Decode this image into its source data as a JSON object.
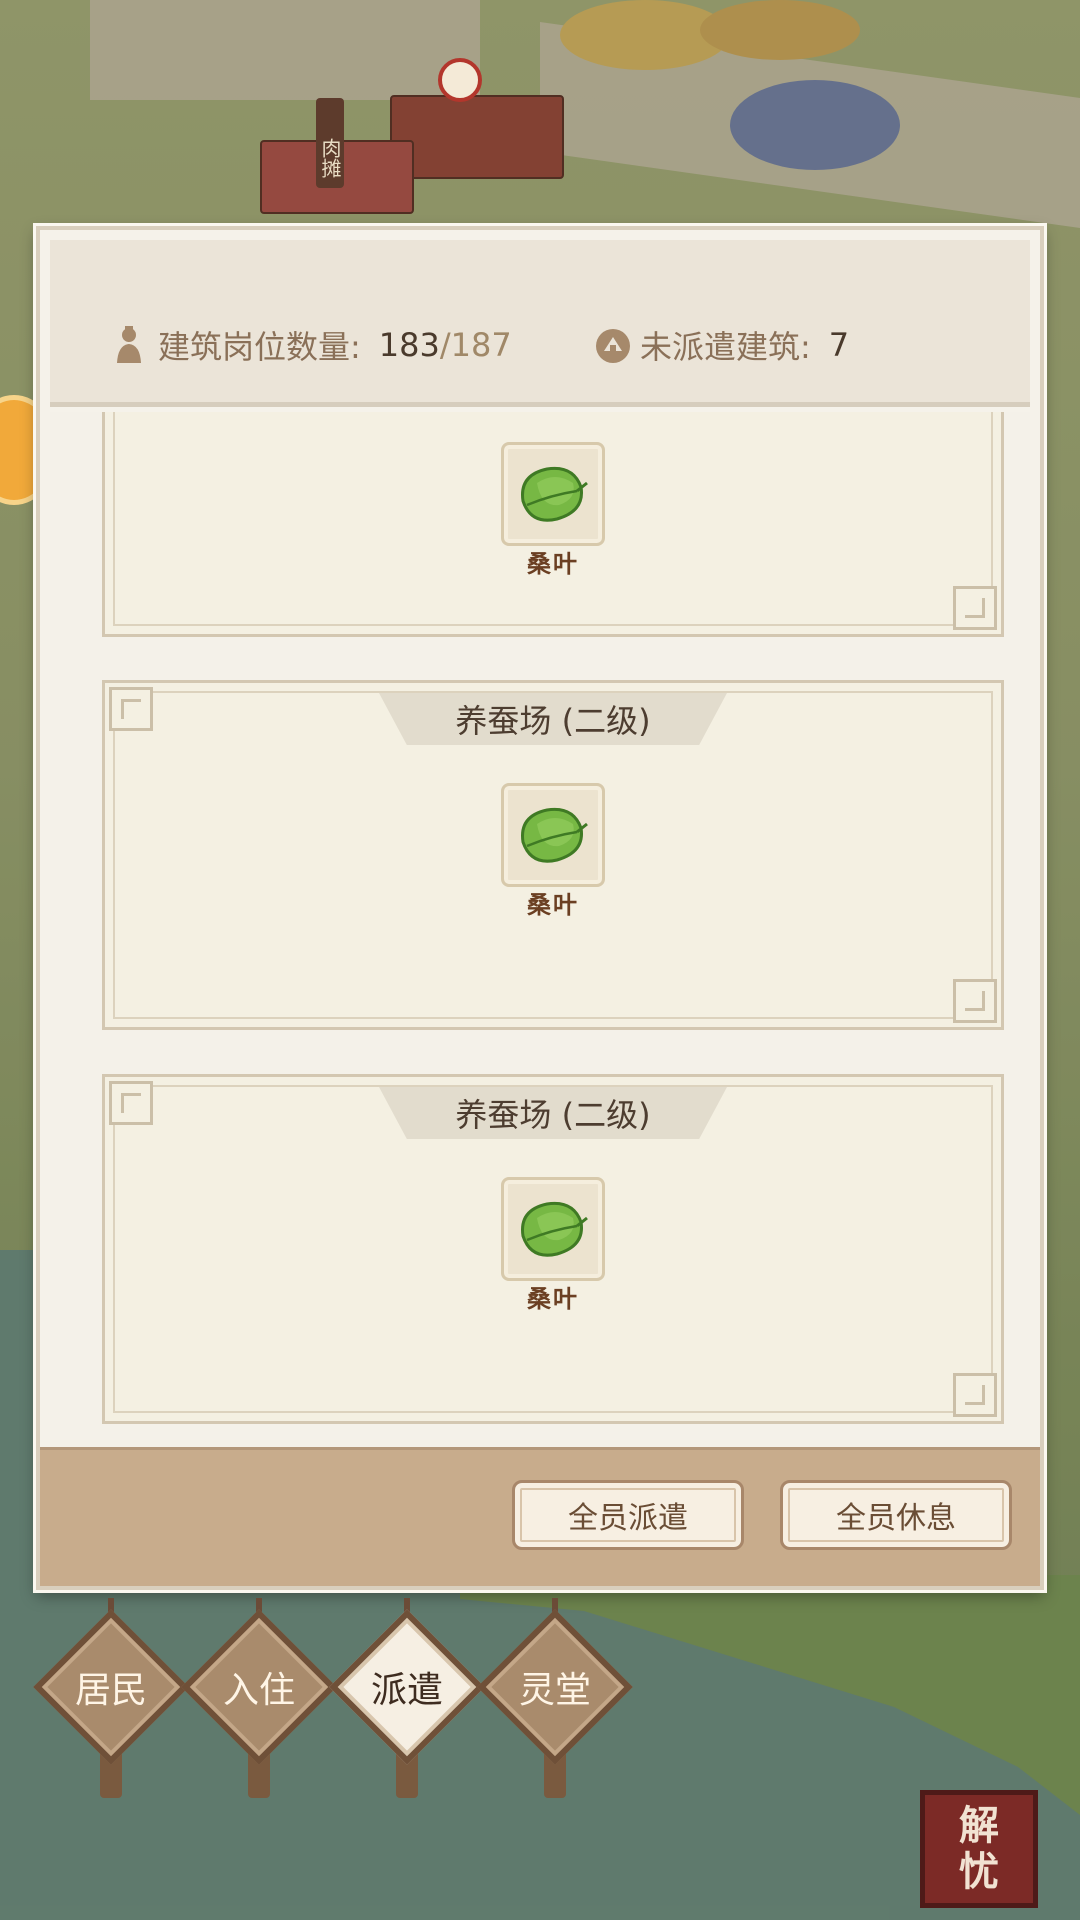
{
  "map": {
    "stall_sign": "肉摊"
  },
  "header": {
    "jobs_label": "建筑岗位数量:",
    "jobs_current": "183",
    "jobs_max": "/187",
    "unassigned_label": "未派遣建筑:",
    "unassigned_count": "7"
  },
  "buildings": [
    {
      "title": "",
      "item": {
        "label": "桑叶",
        "icon": "mulberry-leaf-icon"
      }
    },
    {
      "title": "养蚕场 (二级)",
      "item": {
        "label": "桑叶",
        "icon": "mulberry-leaf-icon"
      }
    },
    {
      "title": "养蚕场 (二级)",
      "item": {
        "label": "桑叶",
        "icon": "mulberry-leaf-icon"
      }
    }
  ],
  "footer": {
    "dispatch_all": "全员派遣",
    "rest_all": "全员休息"
  },
  "tabs": [
    {
      "label": "居民",
      "active": false
    },
    {
      "label": "入住",
      "active": false
    },
    {
      "label": "派遣",
      "active": true
    },
    {
      "label": "灵堂",
      "active": false
    }
  ],
  "seal": {
    "line1": "解",
    "line2": "忧"
  },
  "colors": {
    "panel_bg": "#f5f2ea",
    "footer_bg": "#c8ac8c",
    "leaf_green": "#6fb23c",
    "text_brown": "#6b3f22"
  }
}
